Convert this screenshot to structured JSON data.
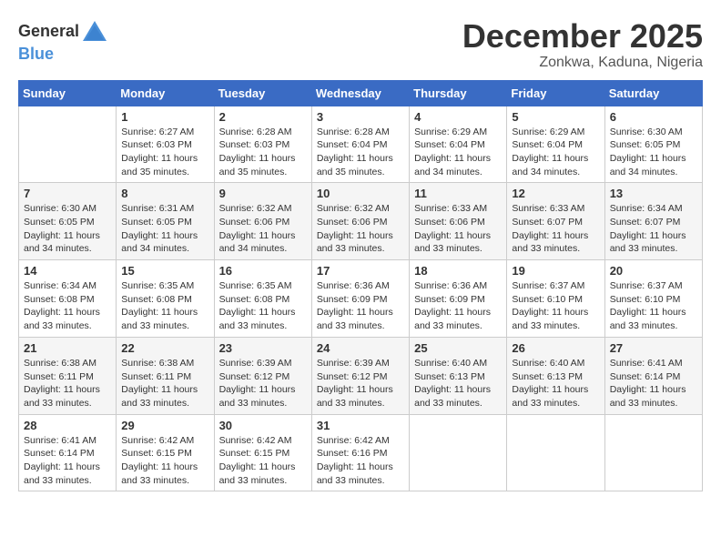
{
  "header": {
    "logo_general": "General",
    "logo_blue": "Blue",
    "month": "December 2025",
    "location": "Zonkwa, Kaduna, Nigeria"
  },
  "days_of_week": [
    "Sunday",
    "Monday",
    "Tuesday",
    "Wednesday",
    "Thursday",
    "Friday",
    "Saturday"
  ],
  "weeks": [
    [
      {
        "day": "",
        "info": ""
      },
      {
        "day": "1",
        "info": "Sunrise: 6:27 AM\nSunset: 6:03 PM\nDaylight: 11 hours\nand 35 minutes."
      },
      {
        "day": "2",
        "info": "Sunrise: 6:28 AM\nSunset: 6:03 PM\nDaylight: 11 hours\nand 35 minutes."
      },
      {
        "day": "3",
        "info": "Sunrise: 6:28 AM\nSunset: 6:04 PM\nDaylight: 11 hours\nand 35 minutes."
      },
      {
        "day": "4",
        "info": "Sunrise: 6:29 AM\nSunset: 6:04 PM\nDaylight: 11 hours\nand 34 minutes."
      },
      {
        "day": "5",
        "info": "Sunrise: 6:29 AM\nSunset: 6:04 PM\nDaylight: 11 hours\nand 34 minutes."
      },
      {
        "day": "6",
        "info": "Sunrise: 6:30 AM\nSunset: 6:05 PM\nDaylight: 11 hours\nand 34 minutes."
      }
    ],
    [
      {
        "day": "7",
        "info": "Sunrise: 6:30 AM\nSunset: 6:05 PM\nDaylight: 11 hours\nand 34 minutes."
      },
      {
        "day": "8",
        "info": "Sunrise: 6:31 AM\nSunset: 6:05 PM\nDaylight: 11 hours\nand 34 minutes."
      },
      {
        "day": "9",
        "info": "Sunrise: 6:32 AM\nSunset: 6:06 PM\nDaylight: 11 hours\nand 34 minutes."
      },
      {
        "day": "10",
        "info": "Sunrise: 6:32 AM\nSunset: 6:06 PM\nDaylight: 11 hours\nand 33 minutes."
      },
      {
        "day": "11",
        "info": "Sunrise: 6:33 AM\nSunset: 6:06 PM\nDaylight: 11 hours\nand 33 minutes."
      },
      {
        "day": "12",
        "info": "Sunrise: 6:33 AM\nSunset: 6:07 PM\nDaylight: 11 hours\nand 33 minutes."
      },
      {
        "day": "13",
        "info": "Sunrise: 6:34 AM\nSunset: 6:07 PM\nDaylight: 11 hours\nand 33 minutes."
      }
    ],
    [
      {
        "day": "14",
        "info": "Sunrise: 6:34 AM\nSunset: 6:08 PM\nDaylight: 11 hours\nand 33 minutes."
      },
      {
        "day": "15",
        "info": "Sunrise: 6:35 AM\nSunset: 6:08 PM\nDaylight: 11 hours\nand 33 minutes."
      },
      {
        "day": "16",
        "info": "Sunrise: 6:35 AM\nSunset: 6:08 PM\nDaylight: 11 hours\nand 33 minutes."
      },
      {
        "day": "17",
        "info": "Sunrise: 6:36 AM\nSunset: 6:09 PM\nDaylight: 11 hours\nand 33 minutes."
      },
      {
        "day": "18",
        "info": "Sunrise: 6:36 AM\nSunset: 6:09 PM\nDaylight: 11 hours\nand 33 minutes."
      },
      {
        "day": "19",
        "info": "Sunrise: 6:37 AM\nSunset: 6:10 PM\nDaylight: 11 hours\nand 33 minutes."
      },
      {
        "day": "20",
        "info": "Sunrise: 6:37 AM\nSunset: 6:10 PM\nDaylight: 11 hours\nand 33 minutes."
      }
    ],
    [
      {
        "day": "21",
        "info": "Sunrise: 6:38 AM\nSunset: 6:11 PM\nDaylight: 11 hours\nand 33 minutes."
      },
      {
        "day": "22",
        "info": "Sunrise: 6:38 AM\nSunset: 6:11 PM\nDaylight: 11 hours\nand 33 minutes."
      },
      {
        "day": "23",
        "info": "Sunrise: 6:39 AM\nSunset: 6:12 PM\nDaylight: 11 hours\nand 33 minutes."
      },
      {
        "day": "24",
        "info": "Sunrise: 6:39 AM\nSunset: 6:12 PM\nDaylight: 11 hours\nand 33 minutes."
      },
      {
        "day": "25",
        "info": "Sunrise: 6:40 AM\nSunset: 6:13 PM\nDaylight: 11 hours\nand 33 minutes."
      },
      {
        "day": "26",
        "info": "Sunrise: 6:40 AM\nSunset: 6:13 PM\nDaylight: 11 hours\nand 33 minutes."
      },
      {
        "day": "27",
        "info": "Sunrise: 6:41 AM\nSunset: 6:14 PM\nDaylight: 11 hours\nand 33 minutes."
      }
    ],
    [
      {
        "day": "28",
        "info": "Sunrise: 6:41 AM\nSunset: 6:14 PM\nDaylight: 11 hours\nand 33 minutes."
      },
      {
        "day": "29",
        "info": "Sunrise: 6:42 AM\nSunset: 6:15 PM\nDaylight: 11 hours\nand 33 minutes."
      },
      {
        "day": "30",
        "info": "Sunrise: 6:42 AM\nSunset: 6:15 PM\nDaylight: 11 hours\nand 33 minutes."
      },
      {
        "day": "31",
        "info": "Sunrise: 6:42 AM\nSunset: 6:16 PM\nDaylight: 11 hours\nand 33 minutes."
      },
      {
        "day": "",
        "info": ""
      },
      {
        "day": "",
        "info": ""
      },
      {
        "day": "",
        "info": ""
      }
    ]
  ]
}
